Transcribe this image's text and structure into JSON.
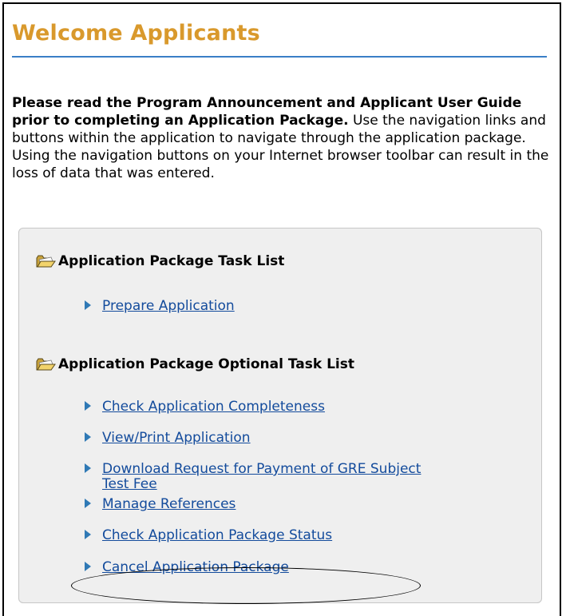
{
  "page": {
    "title": "Welcome Applicants"
  },
  "intro": {
    "bold_text": "Please read the Program Announcement and Applicant User Guide prior to completing an Application Package.",
    "body_text": " Use the navigation links and buttons within the application to navigate through the application package. Using the navigation buttons on your Internet browser toolbar can result in the loss of data that was entered."
  },
  "task_list": {
    "heading": "Application Package Task List",
    "items": [
      {
        "label": "Prepare Application"
      }
    ]
  },
  "optional_task_list": {
    "heading": "Application Package Optional Task List",
    "items": [
      {
        "label": "Check Application Completeness"
      },
      {
        "label": "View/Print Application"
      },
      {
        "label": "Download Request for Payment of GRE Subject Test Fee"
      },
      {
        "label": "Manage References"
      },
      {
        "label": "Check Application Package Status"
      },
      {
        "label": "Cancel Application Package"
      }
    ]
  },
  "icons": {
    "section_icon": "open-folder-icon",
    "item_icon": "arrow-right-icon"
  },
  "colors": {
    "title": "#d9992c",
    "rule": "#3a7fc6",
    "link": "#134b9c",
    "arrow": "#2f79b5",
    "panel_bg": "#efefef"
  }
}
